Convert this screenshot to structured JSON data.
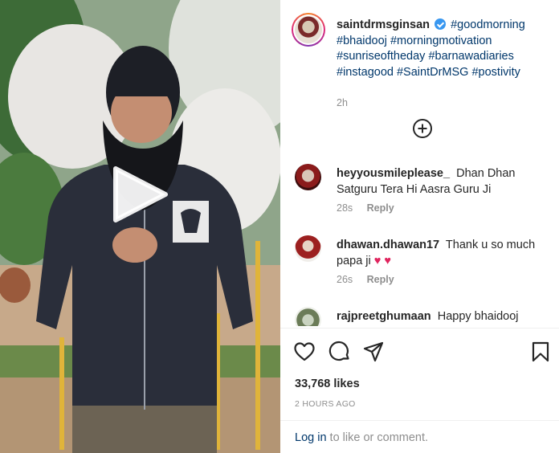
{
  "post": {
    "username": "saintdrmsginsan",
    "hashtags": [
      "#goodmorning",
      "#bhaidooj",
      "#morningmotivation",
      "#sunriseoftheday",
      "#barnawadiaries",
      "#instagood",
      "#SaintDrMSG",
      "#postivity"
    ],
    "time": "2h"
  },
  "comments": [
    {
      "user": "heyyousmileplease_",
      "text": "Dhan Dhan Satguru Tera Hi Aasra Guru Ji",
      "time": "28s",
      "reply": "Reply"
    },
    {
      "user": "dhawan.dhawan17",
      "text": "Thank u so much papa ji",
      "emoji": "♥ ♥",
      "time": "26s",
      "reply": "Reply"
    },
    {
      "user": "rajpreetghumaan",
      "text": "Happy bhaidooj papa"
    }
  ],
  "stats": {
    "likes": "33,768 likes",
    "time_ago": "2 HOURS AGO"
  },
  "login": {
    "link": "Log in",
    "suffix": "to like or comment."
  },
  "icons": {
    "play": "play-icon",
    "load_more": "plus-circle-icon",
    "like": "heart-icon",
    "comment": "comment-icon",
    "share": "paper-plane-icon",
    "save": "bookmark-icon"
  },
  "colors": {
    "hashtag": "#00376b",
    "verified": "#3897f0",
    "muted": "#8e8e8e",
    "heart": "#e0245e"
  }
}
